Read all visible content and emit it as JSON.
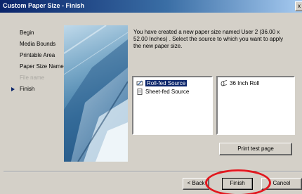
{
  "window": {
    "title": "Custom Paper Size - Finish",
    "close_glyph": "x"
  },
  "steps": [
    {
      "label": "Begin",
      "state": "done"
    },
    {
      "label": "Media Bounds",
      "state": "done"
    },
    {
      "label": "Printable Area",
      "state": "done"
    },
    {
      "label": "Paper Size Name",
      "state": "done"
    },
    {
      "label": "File name",
      "state": "disabled"
    },
    {
      "label": "Finish",
      "state": "current"
    }
  ],
  "description": "You have created a new paper size named User 2 (36.00 x 52.00 Inches) . Select the source to which you want to apply the new paper size.",
  "source_list": [
    {
      "label": "Roll-fed Source",
      "selected": true,
      "icon": "roll-feed-icon"
    },
    {
      "label": "Sheet-fed Source",
      "selected": false,
      "icon": "sheet-feed-icon"
    }
  ],
  "roll_list": [
    {
      "label": "36 Inch Roll",
      "icon": "paper-roll-icon"
    }
  ],
  "buttons": {
    "print_test": "Print test page",
    "back": "< Back",
    "finish": "Finish",
    "cancel": "Cancel"
  },
  "colors": {
    "titlebar": "#0a246a",
    "selection": "#0a246a",
    "annotation": "#e2171e"
  }
}
